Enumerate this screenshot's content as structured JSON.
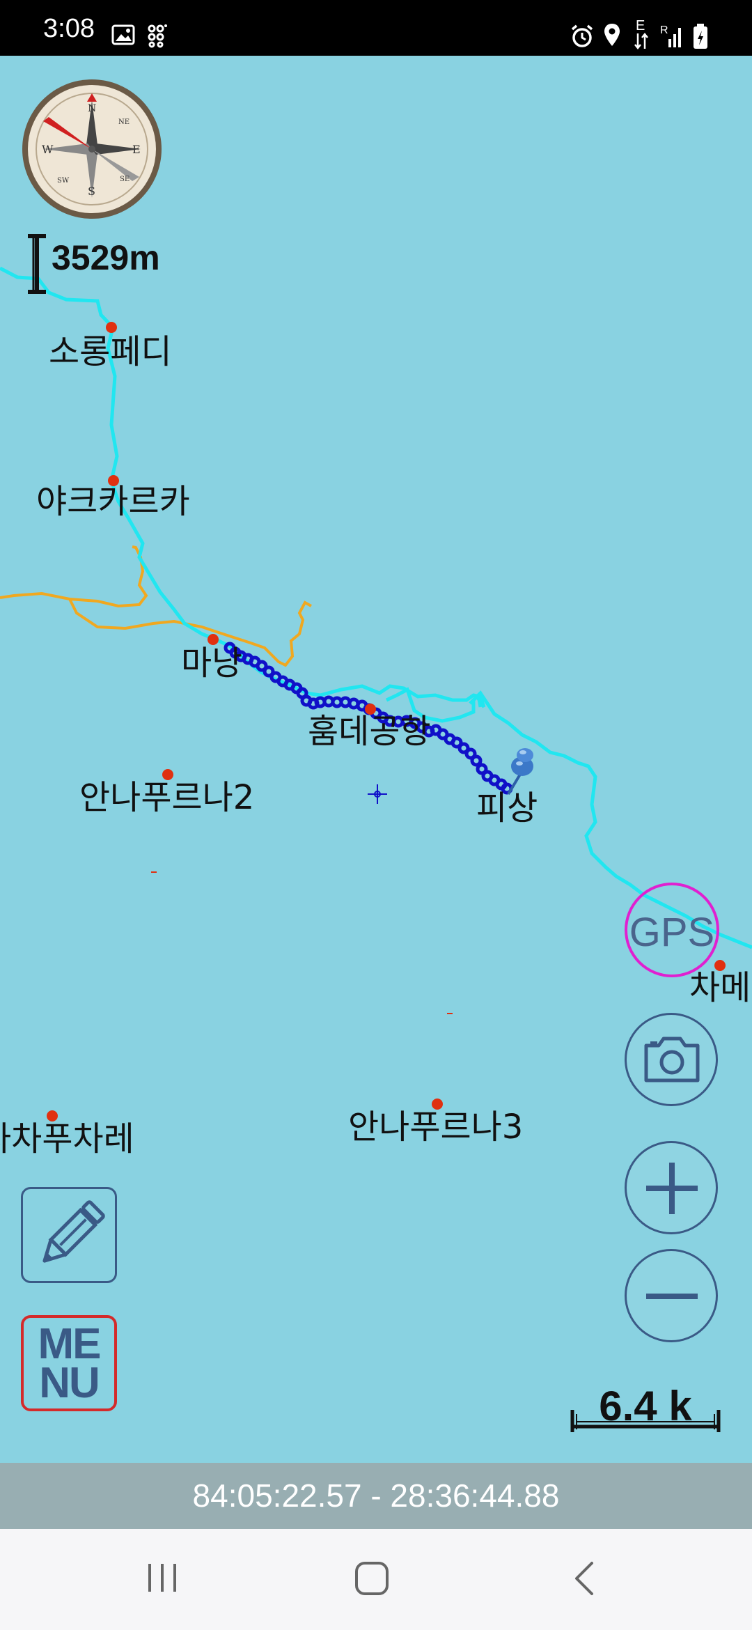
{
  "status_bar": {
    "time": "3:08",
    "left_icons": [
      "image-icon",
      "qr-grid-icon"
    ],
    "right_icons": [
      "alarm-icon",
      "location-icon",
      "data-arrows-icon",
      "signal-icon",
      "battery-icon"
    ],
    "network_label": "E"
  },
  "map": {
    "background_color": "#89d2e1",
    "altitude_label": "3529m",
    "places": {
      "sorongpedi": "소롱페디",
      "yakkarka": "야크카르카",
      "manang": "마낭",
      "humde": "훔데공항",
      "pisang": "피상",
      "annapurna2": "안나푸르나2",
      "chame": "차메",
      "tachaputsare": "타차푸차레",
      "annapurna3": "안나푸르나3"
    },
    "colors": {
      "trail": "#21e6f0",
      "side_trail": "#f0a820",
      "track": "#1010c8",
      "waypoint": "#e03010",
      "gps_ring": "#e020d0",
      "button_outline": "#3a5a86"
    }
  },
  "controls": {
    "gps_label": "GPS",
    "menu_label_line1": "ME",
    "menu_label_line2": "NU",
    "camera_icon": "camera-icon",
    "zoom_in_icon": "plus-icon",
    "zoom_out_icon": "minus-icon",
    "edit_icon": "pencil-icon",
    "compass_icon": "compass-icon"
  },
  "scale_label": "6.4 k",
  "coordinates": "84:05:22.57 - 28:36:44.88",
  "nav_bar": {
    "recents_icon": "recents-icon",
    "home_icon": "home-icon",
    "back_icon": "back-icon"
  }
}
